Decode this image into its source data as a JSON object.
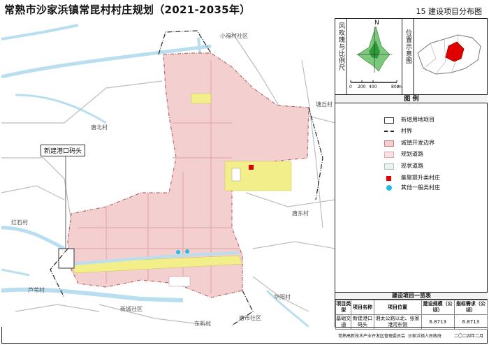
{
  "title": "常熟市沙家浜镇常昆村村庄规划（2021-2035年）",
  "sheet": "15  建设项目分布图",
  "map_labels": {
    "xiaoxiao": "小福村社区",
    "tangbei": "唐北村",
    "tangqiu": "塘丘村",
    "tangdong": "唐东村",
    "hongshi": "红石村",
    "luyu": "芦苇村",
    "xincheng": "新城社区",
    "tangshi": "唐市社区",
    "huayang": "华阳村",
    "dongxin": "东新村"
  },
  "callout": "新建港口码头",
  "wind_panel": {
    "label": "风玫瑰与比例尺",
    "north": "N",
    "scale": [
      "0",
      "200",
      "400",
      "800"
    ],
    "scale_unit": "m"
  },
  "location_panel": {
    "label": "位置示意图"
  },
  "legend": {
    "title": "图    例",
    "items": [
      {
        "name": "新增用地项目",
        "fill": "#ffffff",
        "stroke": "#333333"
      },
      {
        "name": "村界",
        "fill": "none",
        "stroke": "#222222"
      },
      {
        "name": "城镇开发边界",
        "fill": "#f4cfcf",
        "stroke": "#c27a7a"
      },
      {
        "name": "规划道路",
        "fill": "#f7e0e0",
        "stroke": "#e0aaaa"
      },
      {
        "name": "现状道路",
        "fill": "#e8f3ee",
        "stroke": "#a8c6b8"
      },
      {
        "name": "集聚提升类村庄",
        "fill": "#e00000",
        "stroke": "#e00000"
      },
      {
        "name": "其他一般类村庄",
        "fill": "#22bde6",
        "stroke": "#22bde6"
      }
    ]
  },
  "project_table": {
    "title": "建设项目一览表",
    "headers": [
      "项目类型",
      "项目名称",
      "项目位置",
      "建设规模（公顷）",
      "指标需求（公顷）"
    ],
    "rows": [
      [
        "基础交通",
        "新建港口码头",
        "湘太公路以北、张家港河东侧",
        "6.8713",
        "6.8713"
      ]
    ]
  },
  "footer": {
    "org1": "常熟高新技术产业开发区管理委员会",
    "org2": "沙家浜镇人民政府",
    "date": "二〇二四年二月"
  },
  "colors": {
    "accent_red": "#e00000",
    "accent_blue": "#22bde6",
    "village_pink": "#f4cfcf",
    "water": "#b9def0"
  }
}
